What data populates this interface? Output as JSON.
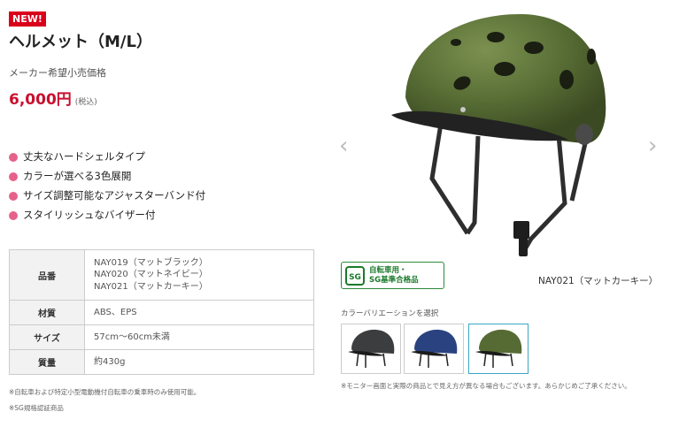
{
  "product": {
    "badge": "NEW!",
    "title": "ヘルメット（M/L）",
    "msrp_label": "メーカー希望小売価格",
    "price": "6,000円",
    "tax_note": "(税込)"
  },
  "features": [
    "丈夫なハードシェルタイプ",
    "カラーが選べる3色展開",
    "サイズ調整可能なアジャスターバンド付",
    "スタイリッシュなバイザー付"
  ],
  "specs": {
    "rows": [
      {
        "label": "品番",
        "lines": [
          "NAY019（マットブラック）",
          "NAY020（マットネイビー）",
          "NAY021（マットカーキー）"
        ]
      },
      {
        "label": "材質",
        "lines": [
          "ABS、EPS"
        ]
      },
      {
        "label": "サイズ",
        "lines": [
          "57cm〜60cm未満"
        ]
      },
      {
        "label": "質量",
        "lines": [
          "約430g"
        ]
      }
    ]
  },
  "notes": [
    "※自転車および特定小型電動機付自転車の乗車時のみ使用可能。",
    "※SG規格認証商品"
  ],
  "gallery": {
    "prev_arrow": "‹",
    "next_arrow": "›",
    "sg_mark_line1": "自転車用・",
    "sg_mark_line2": "SG基準合格品",
    "sg_logo_text": "SG",
    "selected_variant_name": "NAY021（マットカーキー）",
    "variation_label": "カラーバリエーションを選択",
    "thumbnails": [
      {
        "name": "matte-black",
        "color": "#3c3d3e"
      },
      {
        "name": "matte-navy",
        "color": "#2a4380"
      },
      {
        "name": "matte-khaki",
        "color": "#556b33",
        "selected": true
      }
    ],
    "disclaimer": "※モニター画面と実際の商品とで見え方が異なる場合もございます。あらかじめご了承ください。"
  },
  "colors": {
    "accent_red": "#c8102e",
    "badge_red": "#d9001b",
    "bullet_pink": "#e6628a",
    "sg_green": "#2d8a3a",
    "helmet_khaki": "#556b33",
    "selected_border": "#3aa6c6"
  }
}
